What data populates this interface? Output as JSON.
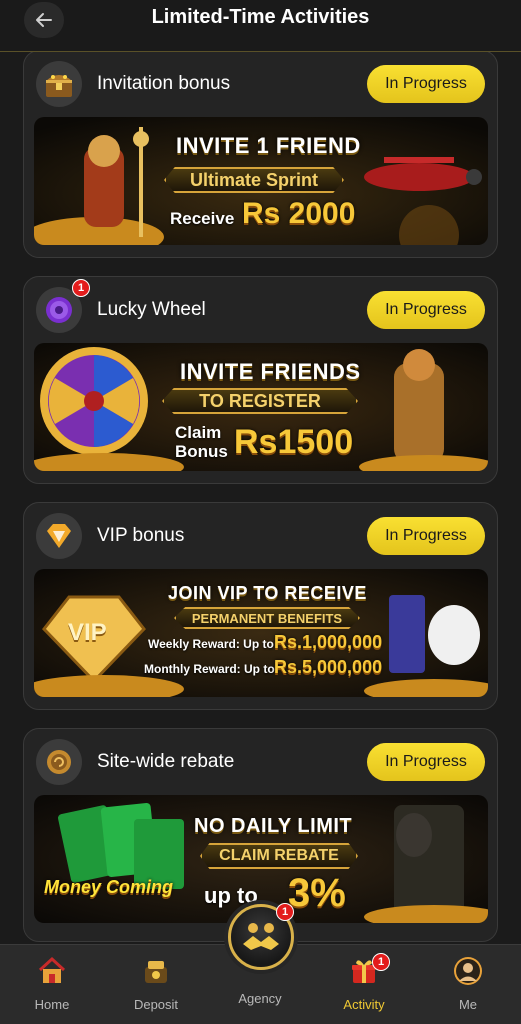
{
  "header": {
    "title": "Limited-Time Activities"
  },
  "cards": [
    {
      "title": "Invitation bonus",
      "button": "In Progress",
      "icon": "treasure-chest-icon",
      "banner": {
        "line1": "INVITE 1 FRIEND",
        "pill": "Ultimate Sprint",
        "receive": "Receive",
        "amount": "Rs 2000"
      }
    },
    {
      "title": "Lucky Wheel",
      "button": "In Progress",
      "icon": "lucky-wheel-icon",
      "badge": "1",
      "banner": {
        "line1": "INVITE FRIENDS",
        "pill": "TO REGISTER",
        "claim": "Claim",
        "bonus": "Bonus",
        "amount": "Rs1500"
      }
    },
    {
      "title": "VIP bonus",
      "button": "In Progress",
      "icon": "vip-diamond-icon",
      "banner": {
        "vip_label": "VIP",
        "line1": "JOIN VIP TO RECEIVE",
        "pill": "PERMANENT BENEFITS",
        "weekly_label": "Weekly Reward: Up to",
        "weekly_amount": "Rs.1,000,000",
        "monthly_label": "Monthly Reward: Up to",
        "monthly_amount": "Rs.5,000,000"
      }
    },
    {
      "title": "Site-wide rebate",
      "button": "In Progress",
      "icon": "rebate-coin-icon",
      "banner": {
        "money_coming": "Money Coming",
        "line1": "NO DAILY LIMIT",
        "pill": "CLAIM REBATE",
        "upto": "up to",
        "percent": "3%"
      }
    }
  ],
  "nav": {
    "home": "Home",
    "deposit": "Deposit",
    "agency": "Agency",
    "agency_badge": "1",
    "activity": "Activity",
    "activity_badge": "1",
    "me": "Me"
  },
  "colors": {
    "accent": "#f0c933",
    "badge": "#e31c1c",
    "background": "#1b1b1b",
    "card": "#242424"
  }
}
